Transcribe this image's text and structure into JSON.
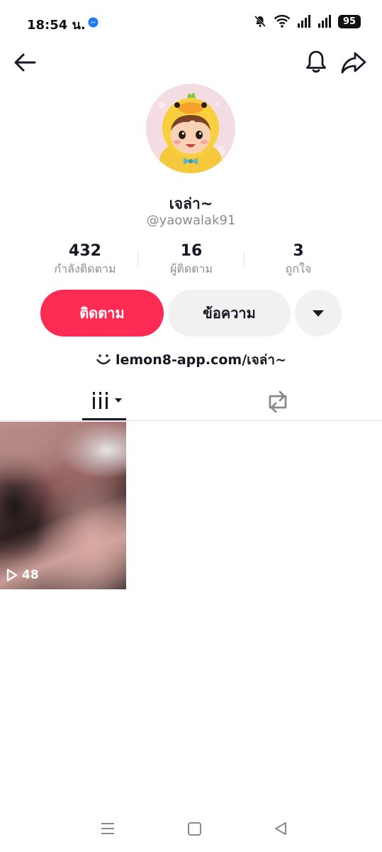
{
  "status_bar": {
    "time": "18:54 น.",
    "battery": "95"
  },
  "profile": {
    "display_name": "เจล่า~",
    "username": "@yaowalak91"
  },
  "stats": [
    {
      "value": "432",
      "label": "กำลังติดตาม"
    },
    {
      "value": "16",
      "label": "ผู้ติดตาม"
    },
    {
      "value": "3",
      "label": "ถูกใจ"
    }
  ],
  "actions": {
    "follow_label": "ติดตาม",
    "message_label": "ข้อความ"
  },
  "bio": {
    "link_text": "lemon8-app.com/เจล่า~"
  },
  "tabs": {
    "active": "videos"
  },
  "videos": [
    {
      "plays": "48"
    }
  ],
  "colors": {
    "accent": "#fe2c55",
    "secondary_button": "#f1f1f2",
    "text_primary": "#161823",
    "text_secondary": "#8a8b91"
  },
  "icons": [
    "back-arrow-icon",
    "bell-icon",
    "share-icon",
    "caret-down-icon",
    "lemon8-smile-icon",
    "video-grid-icon",
    "repost-icon",
    "play-icon"
  ]
}
